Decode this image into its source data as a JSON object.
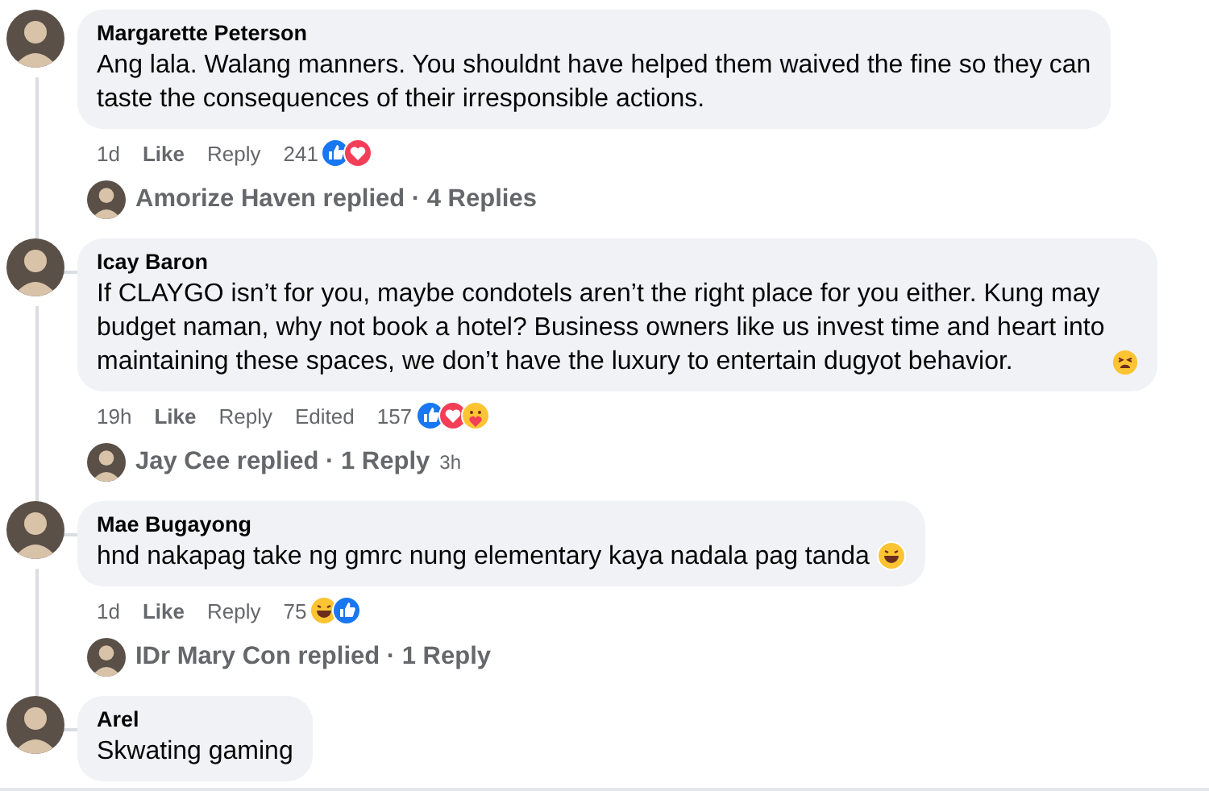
{
  "comments": [
    {
      "author": "Margarette Peterson",
      "lines": [
        "Ang lala. Walang manners. You shouldnt have helped them waived the fine so they can",
        "taste the consequences of their irresponsible actions."
      ],
      "meta": {
        "time": "1d",
        "like": "Like",
        "reply": "Reply",
        "count": "241",
        "reactions": [
          {
            "kind": "like"
          },
          {
            "kind": "love"
          }
        ]
      },
      "replies": {
        "text": "Amorize Haven replied · 4 Replies"
      }
    },
    {
      "author": "Icay Baron",
      "lines": [
        "If CLAYGO isn’t for you, maybe condotels aren’t the right place for you either. Kung may",
        "budget naman, why not book a hotel? Business owners like us invest time and heart into",
        "maintaining these spaces, we don’t have the luxury to entertain dugyot behavior."
      ],
      "end_emoji": {
        "kind": "tired"
      },
      "meta": {
        "time": "19h",
        "like": "Like",
        "reply": "Reply",
        "edited": "Edited",
        "count": "157",
        "reactions": [
          {
            "kind": "like"
          },
          {
            "kind": "love"
          },
          {
            "kind": "care"
          }
        ]
      },
      "replies": {
        "text": "Jay Cee replied · 1 Reply",
        "time": "3h"
      }
    },
    {
      "author": "Mae Bugayong",
      "lines": [
        "hnd nakapag take ng gmrc nung elementary kaya nadala pag tanda"
      ],
      "end_emoji": {
        "kind": "haha"
      },
      "meta": {
        "time": "1d",
        "like": "Like",
        "reply": "Reply",
        "count": "75",
        "reactions": [
          {
            "kind": "haha"
          },
          {
            "kind": "like"
          }
        ]
      },
      "replies": {
        "text": "IDr Mary Con replied · 1 Reply"
      }
    },
    {
      "author": "Arel",
      "lines": [
        "Skwating gaming"
      ]
    }
  ]
}
